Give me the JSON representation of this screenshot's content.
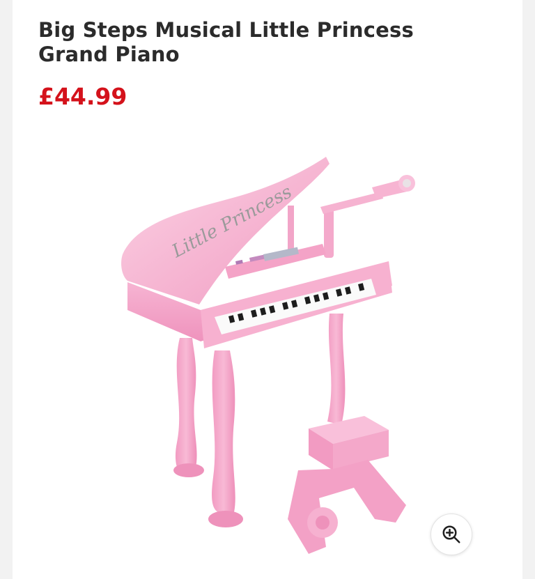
{
  "product": {
    "title": "Big Steps Musical Little Princess Grand Piano",
    "price": "£44.99",
    "image": {
      "alt": "Pink toy grand piano with microphone and stool",
      "lid_script": "Little Princess"
    }
  },
  "zoom_button": {
    "icon": "zoom-in-icon"
  },
  "colors": {
    "price": "#d4121b",
    "title": "#2b2b2b",
    "piano_pink": "#f6a8cb"
  }
}
